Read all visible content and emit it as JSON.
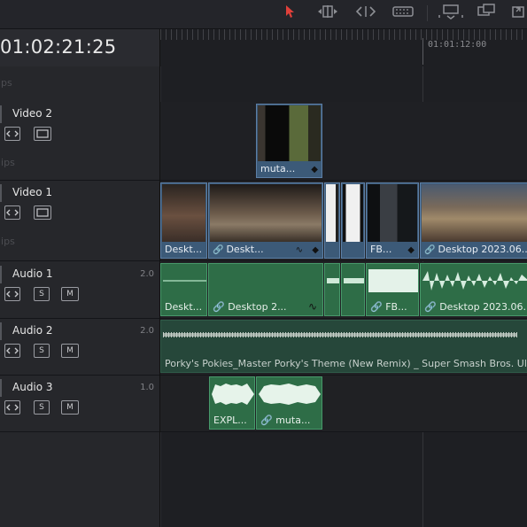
{
  "timecode": "01:02:21:25",
  "ruler": {
    "time_label": "01:01:12:00"
  },
  "toolbar": {
    "icons": [
      "select-pointer-icon",
      "trim-edit-icon",
      "dynamic-trim-icon",
      "blade-icon",
      "insert-clip-icon",
      "overwrite-clip-icon",
      "replace-clip-icon"
    ]
  },
  "tracks": {
    "video2": {
      "name": "Video 2",
      "empty_label": "lips"
    },
    "video1": {
      "name": "Video 1",
      "empty_label": "lips"
    },
    "audio1": {
      "name": "Audio 1",
      "level": "2.0",
      "solo": "S",
      "mute": "M"
    },
    "audio2": {
      "name": "Audio 2",
      "level": "2.0",
      "solo": "S",
      "mute": "M"
    },
    "audio3": {
      "name": "Audio 3",
      "level": "1.0",
      "solo": "S",
      "mute": "M"
    },
    "top_empty_label": "ips"
  },
  "clips": {
    "v2_muta": "muta...",
    "v1_a": "Deskt...",
    "v1_b": "Deskt...",
    "v1_fb": "FB...",
    "v1_desktop": "Desktop 2023.06...",
    "a1_a": "Deskt...",
    "a1_b": "Desktop 2...",
    "a1_fb": "FB...",
    "a1_desktop": "Desktop 2023.06...",
    "a2_music": "Porky's Pokies_Master Porky's Theme (New Remix) _ Super Smash Bros. Ultim",
    "a3_expl": "EXPL...",
    "a3_muta": "muta..."
  },
  "colors": {
    "video_clip": "#3c5a78",
    "audio_clip": "#2e6d47",
    "pointer_accent": "#e0403a"
  }
}
